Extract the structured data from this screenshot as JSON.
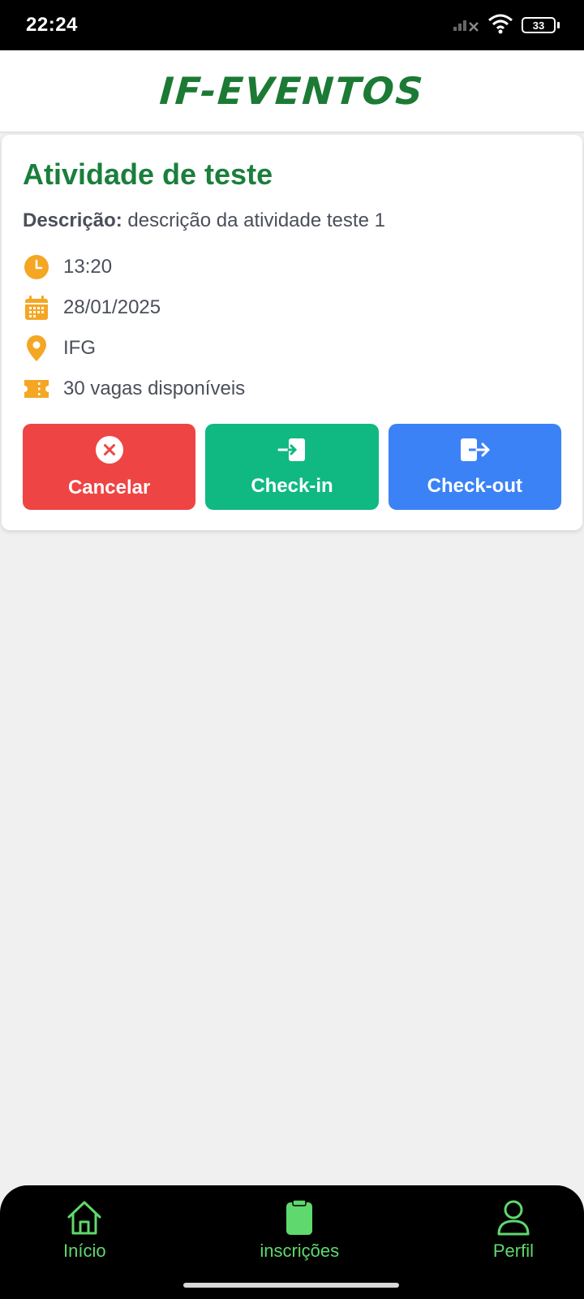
{
  "status_bar": {
    "time": "22:24",
    "battery": "33",
    "icons": [
      "signal-icon",
      "wifi-icon",
      "battery-icon"
    ]
  },
  "header": {
    "logo_text": "IF-EVENTOS"
  },
  "activity": {
    "title": "Atividade de teste",
    "description_label": "Descrição:",
    "description": "descrição da atividade teste 1",
    "time": "13:20",
    "date": "28/01/2025",
    "location": "IFG",
    "vacancies": "30 vagas disponíveis"
  },
  "actions": {
    "cancel_label": "Cancelar",
    "checkin_label": "Check-in",
    "checkout_label": "Check-out"
  },
  "bottom_nav": {
    "items": [
      {
        "label": "Início",
        "icon": "home-icon"
      },
      {
        "label": "inscrições",
        "icon": "clipboard-icon"
      },
      {
        "label": "Perfil",
        "icon": "user-icon"
      }
    ]
  },
  "colors": {
    "primary_green": "#1a7f3c",
    "accent_orange": "#f5a623",
    "cancel_red": "#ef4444",
    "checkin_green": "#10b981",
    "checkout_blue": "#3b82f6",
    "nav_green": "#5fd86d"
  }
}
